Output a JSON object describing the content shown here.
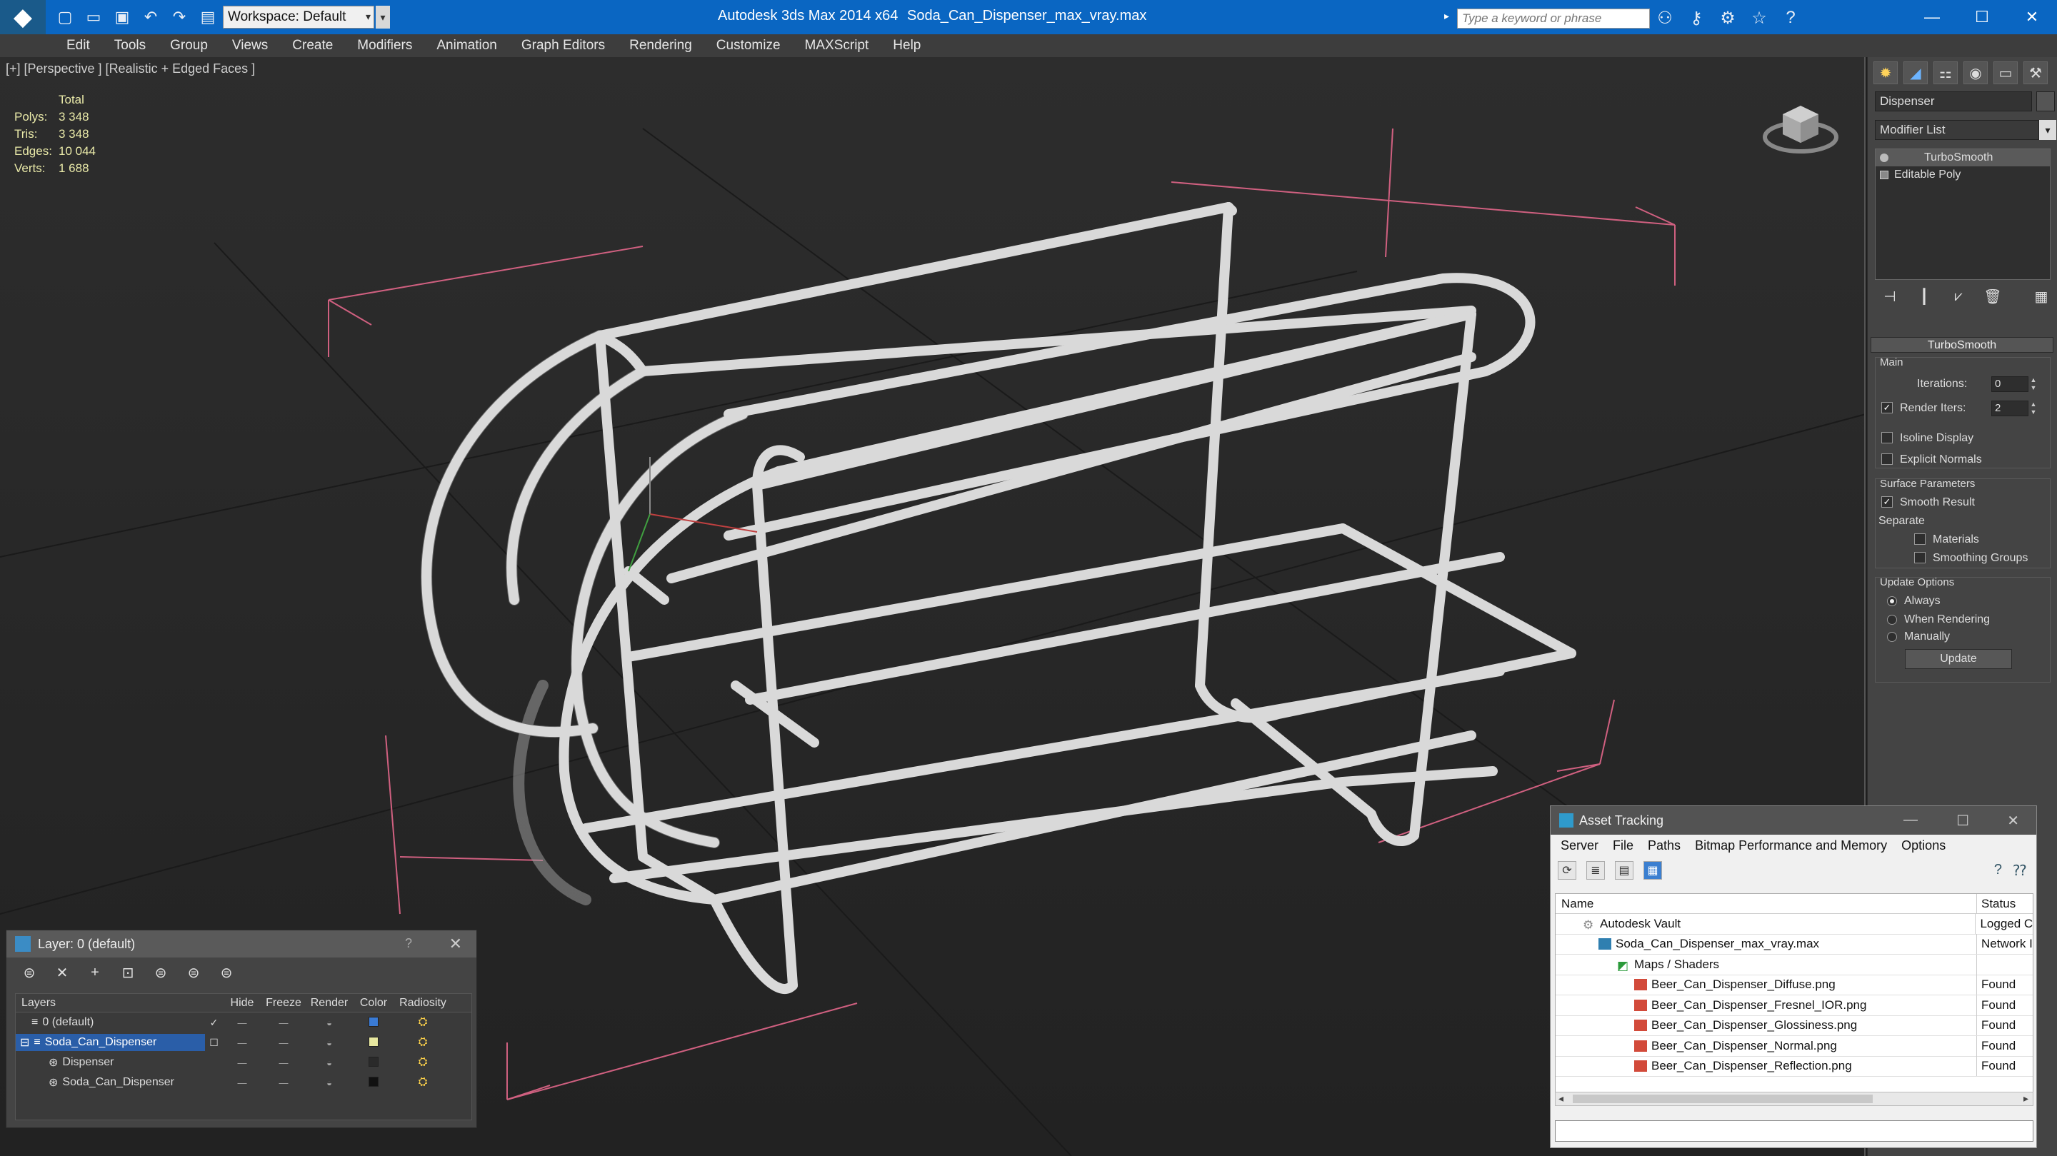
{
  "titlebar": {
    "workspace": "Workspace: Default",
    "app_title": "Autodesk 3ds Max  2014 x64",
    "file_title": "Soda_Can_Dispenser_max_vray.max",
    "search_placeholder": "Type a keyword or phrase"
  },
  "menu": [
    "Edit",
    "Tools",
    "Group",
    "Views",
    "Create",
    "Modifiers",
    "Animation",
    "Graph Editors",
    "Rendering",
    "Customize",
    "MAXScript",
    "Help"
  ],
  "viewport": {
    "label": "[+] [Perspective ] [Realistic + Edged Faces ]",
    "stats_header": "Total",
    "stats": [
      {
        "key": "Polys:",
        "value": "3 348"
      },
      {
        "key": "Tris:",
        "value": "3 348"
      },
      {
        "key": "Edges:",
        "value": "10 044"
      },
      {
        "key": "Verts:",
        "value": "1 688"
      }
    ]
  },
  "command_panel": {
    "object_name": "Dispenser",
    "modifier_list": "Modifier List",
    "stack": [
      "TurboSmooth",
      "Editable Poly"
    ],
    "rollout_title": "TurboSmooth",
    "main_group": "Main",
    "iterations_label": "Iterations:",
    "iterations_value": "0",
    "render_iters_label": "Render Iters:",
    "render_iters_value": "2",
    "isoline_label": "Isoline Display",
    "explicit_normals_label": "Explicit Normals",
    "surface_group": "Surface Parameters",
    "smooth_result_label": "Smooth Result",
    "separate_label": "Separate",
    "materials_label": "Materials",
    "smoothing_groups_label": "Smoothing Groups",
    "update_group": "Update Options",
    "always_label": "Always",
    "when_rendering_label": "When Rendering",
    "manually_label": "Manually",
    "update_button": "Update"
  },
  "layer_panel": {
    "title": "Layer: 0 (default)",
    "columns": [
      "Layers",
      "Hide",
      "Freeze",
      "Render",
      "Color",
      "Radiosity"
    ],
    "rows": [
      {
        "name": "0 (default)",
        "color": "#3a7bd5"
      },
      {
        "name": "Soda_Can_Dispenser",
        "color": "#e8e8a0"
      },
      {
        "name": "Dispenser",
        "color": "#2a2a2a"
      },
      {
        "name": "Soda_Can_Dispenser",
        "color": "#111111"
      }
    ]
  },
  "asset_tracking": {
    "title": "Asset Tracking",
    "menu": [
      "Server",
      "File",
      "Paths",
      "Bitmap Performance and Memory",
      "Options"
    ],
    "columns": {
      "name": "Name",
      "status": "Status"
    },
    "rows": [
      {
        "name": "Autodesk Vault",
        "status": "Logged C"
      },
      {
        "name": "Soda_Can_Dispenser_max_vray.max",
        "status": "Network I"
      },
      {
        "name": "Maps / Shaders",
        "status": ""
      },
      {
        "name": "Beer_Can_Dispenser_Diffuse.png",
        "status": "Found"
      },
      {
        "name": "Beer_Can_Dispenser_Fresnel_IOR.png",
        "status": "Found"
      },
      {
        "name": "Beer_Can_Dispenser_Glossiness.png",
        "status": "Found"
      },
      {
        "name": "Beer_Can_Dispenser_Normal.png",
        "status": "Found"
      },
      {
        "name": "Beer_Can_Dispenser_Reflection.png",
        "status": "Found"
      }
    ]
  }
}
